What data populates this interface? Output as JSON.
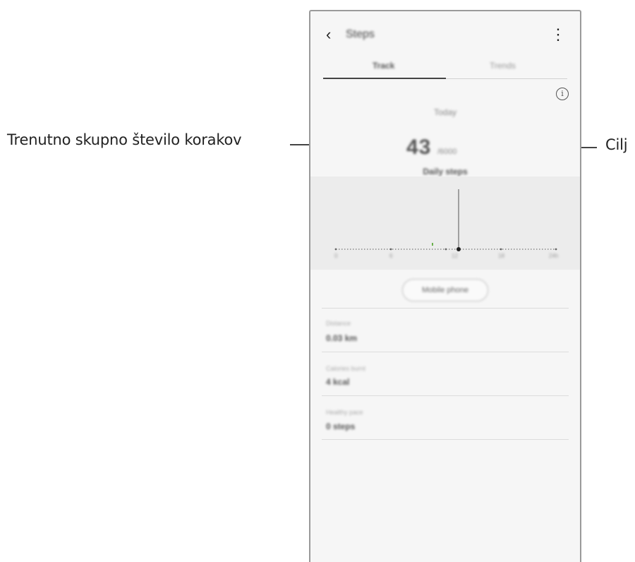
{
  "callouts": {
    "left": "Trenutno skupno število korakov",
    "right": "Cilj"
  },
  "header": {
    "title": "Steps",
    "back_icon": "chevron-left-icon",
    "menu_icon": "more-vertical-icon"
  },
  "tabs": [
    {
      "label": "Track",
      "selected": true
    },
    {
      "label": "Trends",
      "selected": false
    }
  ],
  "summary": {
    "info_icon": "info-icon",
    "day_label": "Today",
    "steps_count": "43",
    "steps_goal": "/6000",
    "section_label": "Daily steps"
  },
  "chart": {
    "tick_labels": [
      "0",
      "6",
      "12",
      "18",
      "24h"
    ]
  },
  "device_button": "Mobile phone",
  "stats": [
    {
      "label": "Distance",
      "value": "0.03 km"
    },
    {
      "label": "Calories burnt",
      "value": "4 kcal"
    },
    {
      "label": "Healthy pace",
      "value": "0 steps"
    }
  ]
}
